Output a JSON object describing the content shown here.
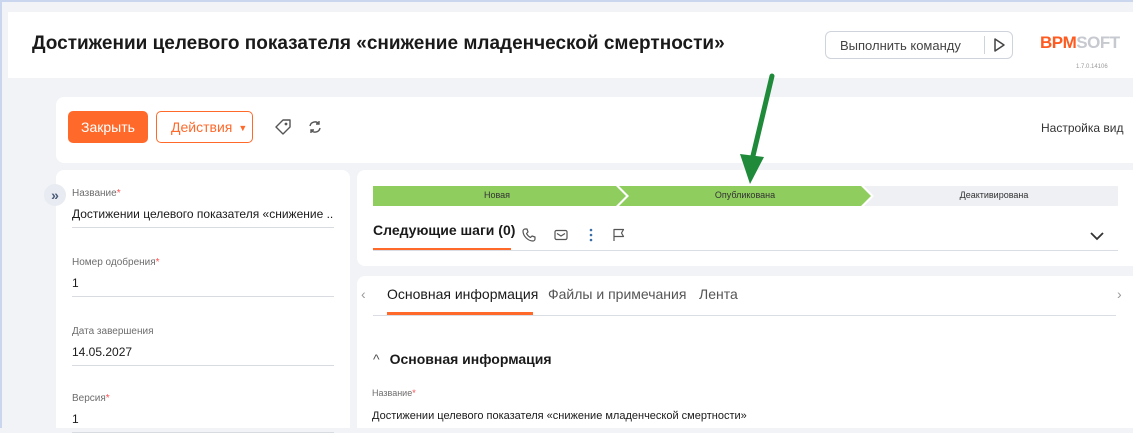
{
  "header": {
    "title": "Достижении целевого показателя «снижение младенческой смертности»",
    "command_label": "Выполнить команду",
    "logo_accent": "BPM",
    "logo_rest": "SOFT",
    "version": "1.7.0.14106"
  },
  "toolbar": {
    "close_label": "Закрыть",
    "actions_label": "Действия",
    "view_settings": "Настройка вид"
  },
  "left_fields": [
    {
      "label": "Название",
      "required": "*",
      "value": "Достижении целевого показателя «снижение ..."
    },
    {
      "label": "Номер одобрения",
      "required": "*",
      "value": "1"
    },
    {
      "label": "Дата завершения",
      "required": "",
      "value": "14.05.2027"
    },
    {
      "label": "Версия",
      "required": "*",
      "value": "1"
    }
  ],
  "stages": {
    "items": [
      {
        "label": "Новая",
        "state": "done"
      },
      {
        "label": "Опубликована",
        "state": "current"
      },
      {
        "label": "Деактивирована",
        "state": "pending"
      }
    ],
    "next_steps": "Следующие шаги (0)"
  },
  "tabs": {
    "items": [
      {
        "label": "Основная информация",
        "active": true
      },
      {
        "label": "Файлы и примечания",
        "active": false
      },
      {
        "label": "Лента",
        "active": false
      }
    ],
    "section_title": "Основная информация",
    "field_label": "Название",
    "field_required": "*",
    "field_value": "Достижении целевого показателя «снижение младенческой смертности»"
  },
  "colors": {
    "accent": "#ff6a2b",
    "stage_done": "#8fcd5f",
    "stage_pending": "#eef0f4",
    "annotation_arrow": "#1f8a3a"
  },
  "icons": [
    "play-icon",
    "tag-icon",
    "refresh-icon",
    "expand-icon",
    "phone-icon",
    "email-icon",
    "more-icon",
    "flag-icon",
    "chevron-down-icon",
    "chevron-left-icon",
    "chevron-right-icon",
    "chevron-up-icon",
    "annotation-arrow"
  ]
}
